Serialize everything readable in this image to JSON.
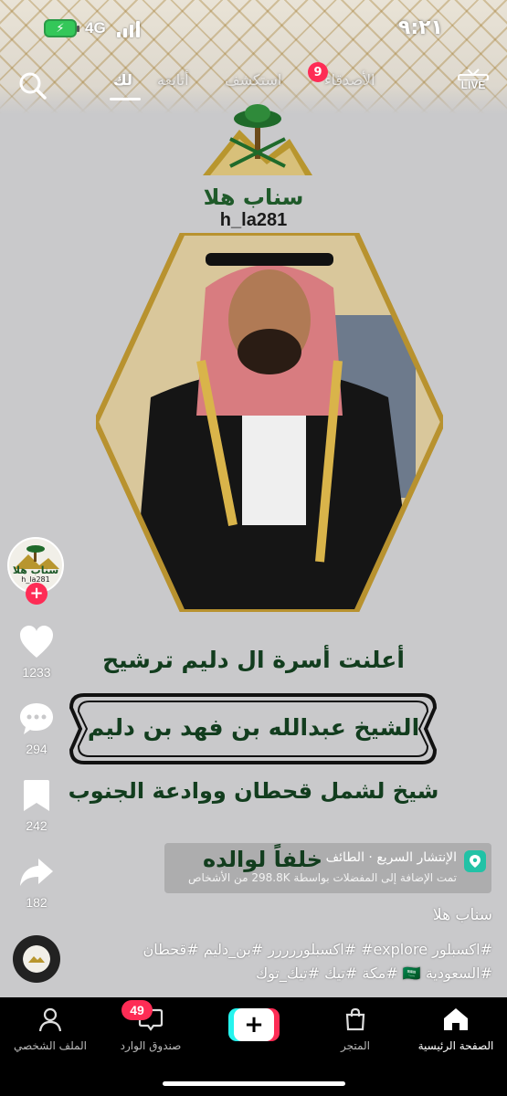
{
  "status_bar": {
    "network": "4G",
    "time": "٩:٢١"
  },
  "top_nav": {
    "tabs": [
      {
        "label": "لك",
        "active": true
      },
      {
        "label": "أتابعه",
        "active": false
      },
      {
        "label": "استكشف",
        "active": false
      },
      {
        "label": "الأصدقاء",
        "active": false
      }
    ],
    "friends_badge": "9",
    "live_label": "LIVE",
    "icons": {
      "search": "search-icon",
      "live": "live-tv-icon"
    }
  },
  "video": {
    "brand_name": "سناب هلا",
    "brand_handle": "h_la281",
    "headline_1": "أعلنت أسرة ال دليم ترشيح",
    "headline_2": "الشيخ عبدالله بن فهد بن دليم",
    "headline_3": "شيخ لشمل قحطان ووادعة الجنوب",
    "headline_4": "خلفاً لوالده"
  },
  "actions": {
    "avatar_caption": "سناب هلا",
    "avatar_handle": "h_la281",
    "likes": "1233",
    "comments": "294",
    "favorites": "242",
    "shares": "182"
  },
  "location": {
    "title": "الإنتشار السريع · الطائف",
    "subtitle": "تمت الإضافة إلى المفضلات بواسطة 298.8K من الأشخاص"
  },
  "caption": {
    "author": "سناب هلا",
    "line_1": "#اكسبلور explore# #اكسبلوررررر #بن_دليم #قحطان",
    "line_2": "#السعودية 🇸🇦 #مكة #تيك #تيك_توك"
  },
  "bottom_bar": {
    "home": "الصفحة الرئيسية",
    "shop": "المتجر",
    "inbox": "صندوق الوارد",
    "profile": "الملف الشخصي",
    "inbox_badge": "49"
  },
  "colors": {
    "accent_red": "#fe2c55",
    "accent_cyan": "#25f4ee",
    "headline_green": "#123d1e",
    "location_icon": "#22c2a6"
  }
}
